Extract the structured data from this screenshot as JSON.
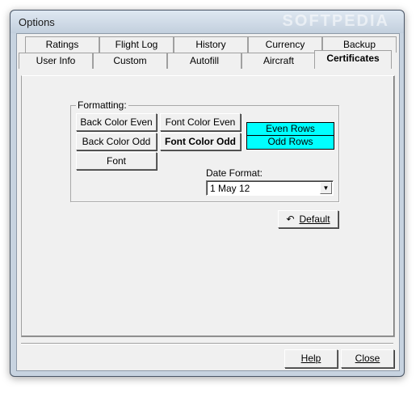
{
  "window": {
    "title": "Options",
    "watermark": "SOFTPEDIA"
  },
  "tabs_back": [
    {
      "label": "Ratings"
    },
    {
      "label": "Flight Log"
    },
    {
      "label": "History"
    },
    {
      "label": "Currency"
    },
    {
      "label": "Backup"
    }
  ],
  "tabs_front": [
    {
      "label": "User Info"
    },
    {
      "label": "Custom"
    },
    {
      "label": "Autofill"
    },
    {
      "label": "Aircraft"
    },
    {
      "label": "Certificates",
      "active": true
    }
  ],
  "formatting": {
    "label": "Formatting:",
    "back_color_even": "Back Color Even",
    "font_color_even": "Font Color Even",
    "back_color_odd": "Back Color Odd",
    "font_color_odd": "Font Color Odd",
    "font": "Font",
    "preview_even": "Even Rows",
    "preview_odd": "Odd Rows",
    "preview_color": "#00ffff",
    "date_format_label": "Date Format:",
    "date_format_value": "1 May 12"
  },
  "default_button": {
    "label": "Default",
    "icon": "undo-icon"
  },
  "footer": {
    "help": "Help",
    "close": "Close"
  }
}
